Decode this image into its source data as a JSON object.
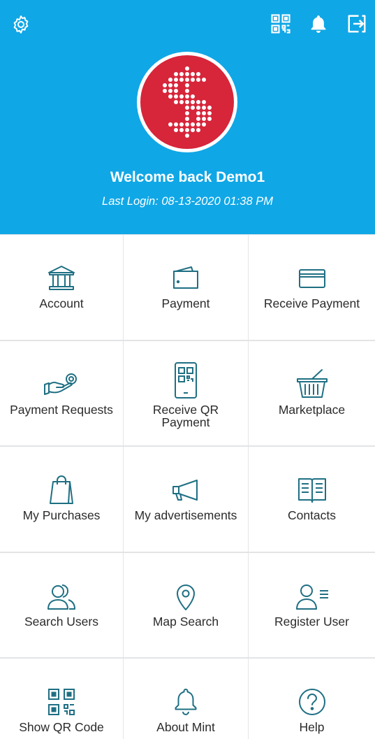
{
  "header": {
    "welcome": "Welcome back Demo1",
    "last_login": "Last Login: 08-13-2020 01:38 PM",
    "icons": [
      "gear-icon",
      "qr-code-icon",
      "bell-icon",
      "logout-icon"
    ],
    "logo": "mint-dollar-logo"
  },
  "colors": {
    "header_bg": "#10a7e6",
    "icon_teal": "#1f6f83",
    "logo_red": "#d7253a",
    "grid_divider": "#e2e4e6"
  },
  "menu": {
    "account": "Account",
    "payment": "Payment",
    "receive_payment": "Receive Payment",
    "payment_requests": "Payment Requests",
    "receive_qr_line1": "Receive QR",
    "receive_qr_line2": "Payment",
    "marketplace": "Marketplace",
    "my_purchases": "My Purchases",
    "my_advertisements": "My advertisements",
    "contacts": "Contacts",
    "search_users": "Search Users",
    "map_search": "Map Search",
    "register_user": "Register User",
    "show_qr_code": "Show QR Code",
    "about_mint": "About Mint",
    "help": "Help"
  }
}
